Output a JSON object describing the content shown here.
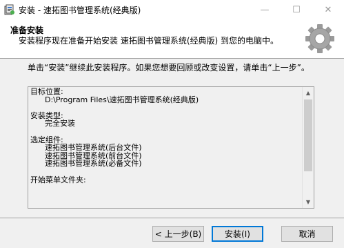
{
  "window": {
    "title": "安装 - 速拓图书管理系统(经典版)",
    "minimize_glyph": "—",
    "maximize_glyph": "☐",
    "close_glyph": "✕"
  },
  "header": {
    "title": "准备安装",
    "description": "安装程序现在准备开始安装 速拓图书管理系统(经典版) 到您的电脑中。"
  },
  "body": {
    "instruction": "单击“安装”继续此安装程序。如果您想要回顾或改变设置，请单击“上一步”。"
  },
  "memo": {
    "text": "目标位置:\n      D:\\Program Files\\速拓图书管理系统(经典版)\n\n安装类型:\n      完全安装\n\n选定组件:\n      速拓图书管理系统(后台文件)\n      速拓图书管理系统(前台文件)\n      速拓图书管理系统(必备文件)\n\n开始菜单文件夹:",
    "scroll_up_glyph": "▲",
    "scroll_down_glyph": "▼"
  },
  "buttons": {
    "back": "< 上一步(B)",
    "install": "安装(I)",
    "cancel": "取消"
  },
  "icons": {
    "app": "installer-app-icon",
    "header": "gear-icon"
  }
}
